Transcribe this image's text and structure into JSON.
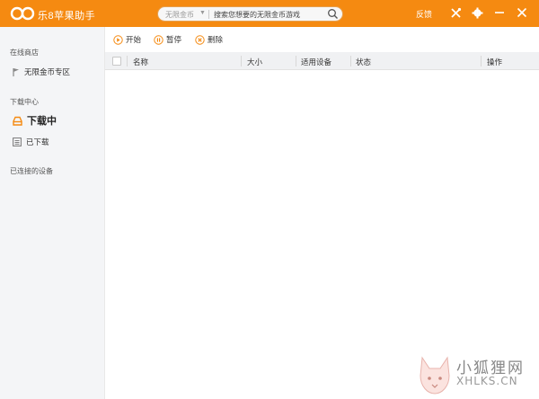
{
  "window": {
    "title": "乐8苹果助手",
    "feedback_label": "反馈"
  },
  "search": {
    "category": "无限金币",
    "placeholder": "搜索您想要的无限金币游戏"
  },
  "sidebar": {
    "sections": [
      {
        "label": "在线商店",
        "items": [
          {
            "label": "无限金币专区",
            "icon": "flag-icon"
          }
        ]
      },
      {
        "label": "下载中心",
        "items": [
          {
            "label": "下载中",
            "icon": "download-tray-icon"
          },
          {
            "label": "已下载",
            "icon": "list-icon"
          }
        ]
      },
      {
        "label": "已连接的设备",
        "items": []
      }
    ]
  },
  "toolbar": {
    "start_label": "开始",
    "pause_label": "暂停",
    "delete_label": "删除"
  },
  "table": {
    "columns": [
      "名称",
      "大小",
      "适用设备",
      "状态",
      "操作"
    ],
    "rows": []
  },
  "watermark": {
    "title": "小狐狸网",
    "url": "XHLKS.CN"
  },
  "colors": {
    "accent": "#f58a11",
    "sidebar_bg": "#f4f5f7",
    "header_bg": "#f0f1f3"
  }
}
